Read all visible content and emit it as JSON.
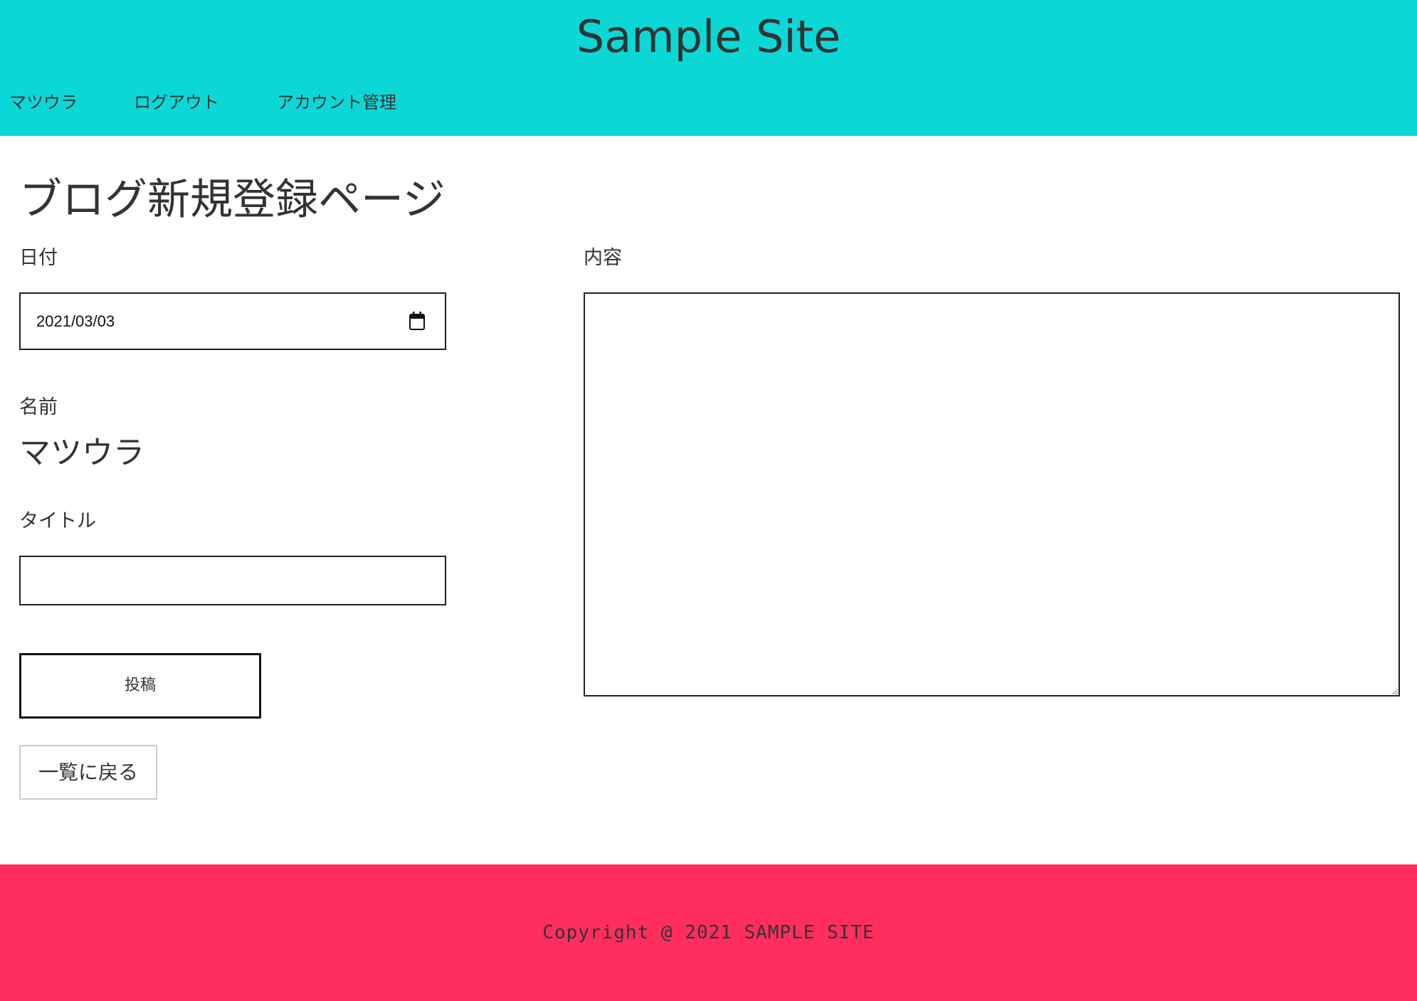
{
  "header": {
    "site_title": "Sample Site",
    "nav": {
      "user": "マツウラ",
      "logout": "ログアウト",
      "account": "アカウント管理"
    },
    "background_color": "#0bd8d6"
  },
  "main": {
    "page_title": "ブログ新規登録ページ",
    "date": {
      "label": "日付",
      "value": "2021/03/03",
      "icon": "calendar-icon"
    },
    "name": {
      "label": "名前",
      "value": "マツウラ"
    },
    "title_field": {
      "label": "タイトル",
      "value": ""
    },
    "content": {
      "label": "内容",
      "value": ""
    },
    "submit_label": "投稿",
    "back_label": "一覧に戻る"
  },
  "footer": {
    "copyright": "Copyright @ 2021 SAMPLE SITE",
    "background_color": "#ff2e5f"
  }
}
